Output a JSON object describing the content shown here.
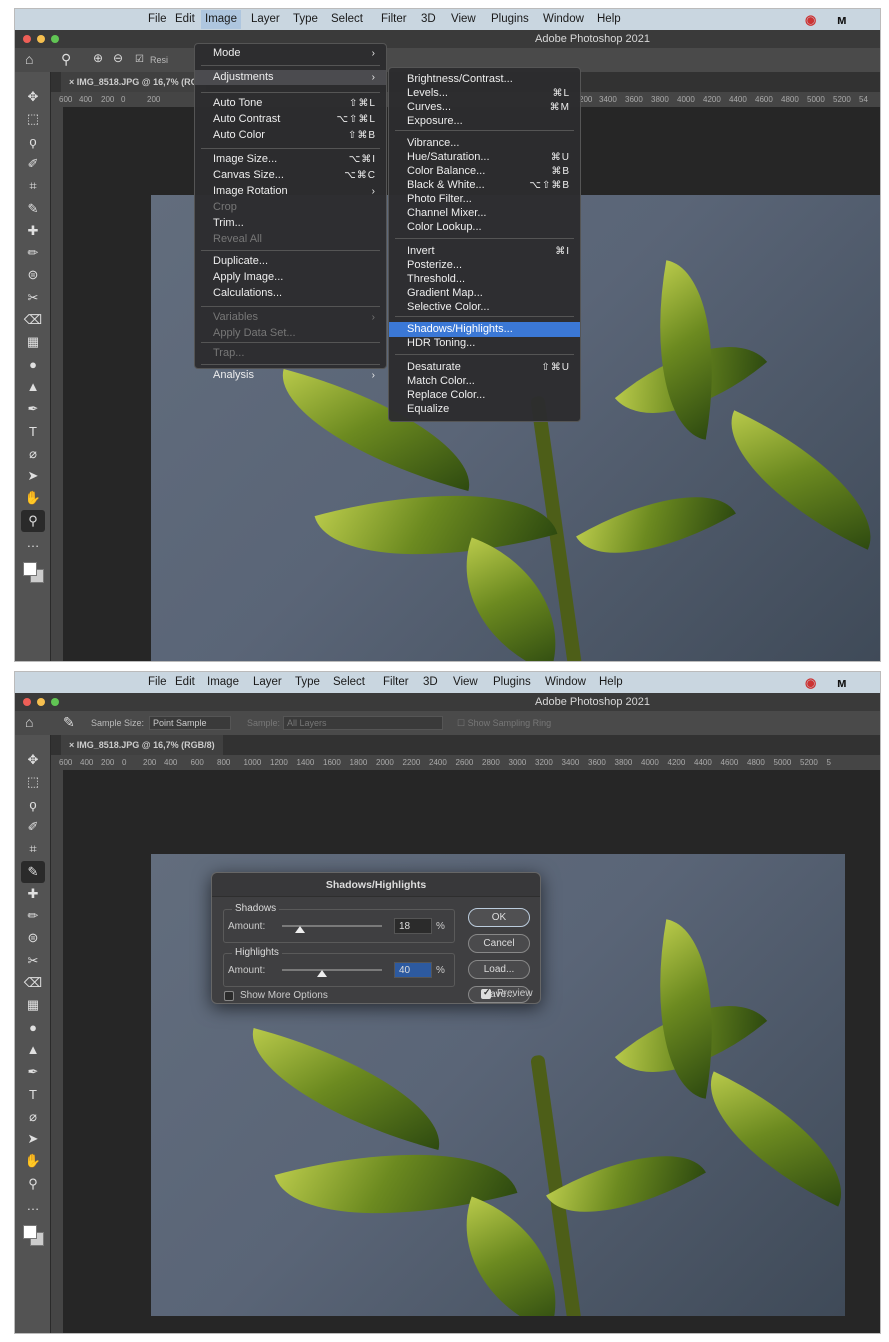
{
  "menubar": {
    "items": [
      "File",
      "Edit",
      "Image",
      "Layer",
      "Type",
      "Select",
      "Filter",
      "3D",
      "View",
      "Plugins",
      "Window",
      "Help"
    ]
  },
  "window": {
    "title": "Adobe Photoshop 2021"
  },
  "panel1": {
    "options": {
      "resize_label": "Resi"
    },
    "tab": {
      "label": "IMG_8518.JPG @ 16,7% (RG"
    },
    "ruler_labels": [
      "600",
      "400",
      "200",
      "0",
      "200"
    ],
    "ruler_labels_right": [
      "200",
      "3400",
      "3600",
      "3800",
      "4000",
      "4200",
      "4400",
      "4600",
      "4800",
      "5000",
      "5200",
      "54"
    ],
    "image_menu": [
      {
        "label": "Mode",
        "shortcut": "",
        "submenu": true,
        "disabled": false
      },
      {
        "label": "Adjustments",
        "shortcut": "",
        "submenu": true,
        "disabled": false
      },
      {
        "label": "Auto Tone",
        "shortcut": "⇧⌘L",
        "submenu": false,
        "disabled": false
      },
      {
        "label": "Auto Contrast",
        "shortcut": "⌥⇧⌘L",
        "submenu": false,
        "disabled": false
      },
      {
        "label": "Auto Color",
        "shortcut": "⇧⌘B",
        "submenu": false,
        "disabled": false
      },
      {
        "label": "Image Size...",
        "shortcut": "⌥⌘I",
        "submenu": false,
        "disabled": false
      },
      {
        "label": "Canvas Size...",
        "shortcut": "⌥⌘C",
        "submenu": false,
        "disabled": false
      },
      {
        "label": "Image Rotation",
        "shortcut": "",
        "submenu": true,
        "disabled": false
      },
      {
        "label": "Crop",
        "shortcut": "",
        "submenu": false,
        "disabled": true
      },
      {
        "label": "Trim...",
        "shortcut": "",
        "submenu": false,
        "disabled": false
      },
      {
        "label": "Reveal All",
        "shortcut": "",
        "submenu": false,
        "disabled": true
      },
      {
        "label": "Duplicate...",
        "shortcut": "",
        "submenu": false,
        "disabled": false
      },
      {
        "label": "Apply Image...",
        "shortcut": "",
        "submenu": false,
        "disabled": false
      },
      {
        "label": "Calculations...",
        "shortcut": "",
        "submenu": false,
        "disabled": false
      },
      {
        "label": "Variables",
        "shortcut": "",
        "submenu": true,
        "disabled": true
      },
      {
        "label": "Apply Data Set...",
        "shortcut": "",
        "submenu": false,
        "disabled": true
      },
      {
        "label": "Trap...",
        "shortcut": "",
        "submenu": false,
        "disabled": true
      },
      {
        "label": "Analysis",
        "shortcut": "",
        "submenu": true,
        "disabled": false
      }
    ],
    "adjust_menu": [
      {
        "label": "Brightness/Contrast...",
        "shortcut": ""
      },
      {
        "label": "Levels...",
        "shortcut": "⌘L"
      },
      {
        "label": "Curves...",
        "shortcut": "⌘M"
      },
      {
        "label": "Exposure...",
        "shortcut": ""
      },
      {
        "label": "Vibrance...",
        "shortcut": ""
      },
      {
        "label": "Hue/Saturation...",
        "shortcut": "⌘U"
      },
      {
        "label": "Color Balance...",
        "shortcut": "⌘B"
      },
      {
        "label": "Black & White...",
        "shortcut": "⌥⇧⌘B"
      },
      {
        "label": "Photo Filter...",
        "shortcut": ""
      },
      {
        "label": "Channel Mixer...",
        "shortcut": ""
      },
      {
        "label": "Color Lookup...",
        "shortcut": ""
      },
      {
        "label": "Invert",
        "shortcut": "⌘I"
      },
      {
        "label": "Posterize...",
        "shortcut": ""
      },
      {
        "label": "Threshold...",
        "shortcut": ""
      },
      {
        "label": "Gradient Map...",
        "shortcut": ""
      },
      {
        "label": "Selective Color...",
        "shortcut": ""
      },
      {
        "label": "Shadows/Highlights...",
        "shortcut": ""
      },
      {
        "label": "HDR Toning...",
        "shortcut": ""
      },
      {
        "label": "Desaturate",
        "shortcut": "⇧⌘U"
      },
      {
        "label": "Match Color...",
        "shortcut": ""
      },
      {
        "label": "Replace Color...",
        "shortcut": ""
      },
      {
        "label": "Equalize",
        "shortcut": ""
      }
    ],
    "highlighted_item": "Shadows/Highlights..."
  },
  "panel2": {
    "options": {
      "sample_size_label": "Sample Size:",
      "sample_size_value": "Point Sample",
      "sample_label": "Sample:",
      "sample_value": "All Layers",
      "show_ring_label": "Show Sampling Ring"
    },
    "tab": {
      "label": "IMG_8518.JPG @ 16,7% (RGB/8)"
    },
    "ruler_labels": [
      "600",
      "400",
      "200",
      "0",
      "200",
      "400",
      "600",
      "800",
      "1000",
      "1200",
      "1400",
      "1600",
      "1800",
      "2000",
      "2200",
      "2400",
      "2600",
      "2800",
      "3000",
      "3200",
      "3400",
      "3600",
      "3800",
      "4000",
      "4200",
      "4400",
      "4600",
      "4800",
      "5000",
      "5200",
      "5"
    ],
    "dialog": {
      "title": "Shadows/Highlights",
      "shadows": {
        "group_label": "Shadows",
        "amount_label": "Amount:",
        "value": "18",
        "unit": "%",
        "fraction": 0.18
      },
      "highlights": {
        "group_label": "Highlights",
        "amount_label": "Amount:",
        "value": "40",
        "unit": "%",
        "fraction": 0.4
      },
      "buttons": {
        "ok": "OK",
        "cancel": "Cancel",
        "load": "Load...",
        "save": "Save..."
      },
      "show_more_label": "Show More Options",
      "show_more_checked": false,
      "preview_label": "Preview",
      "preview_checked": true
    }
  },
  "colors": {
    "menu_highlight": "#3b78d6",
    "accent_field": "#2d5aa0"
  }
}
